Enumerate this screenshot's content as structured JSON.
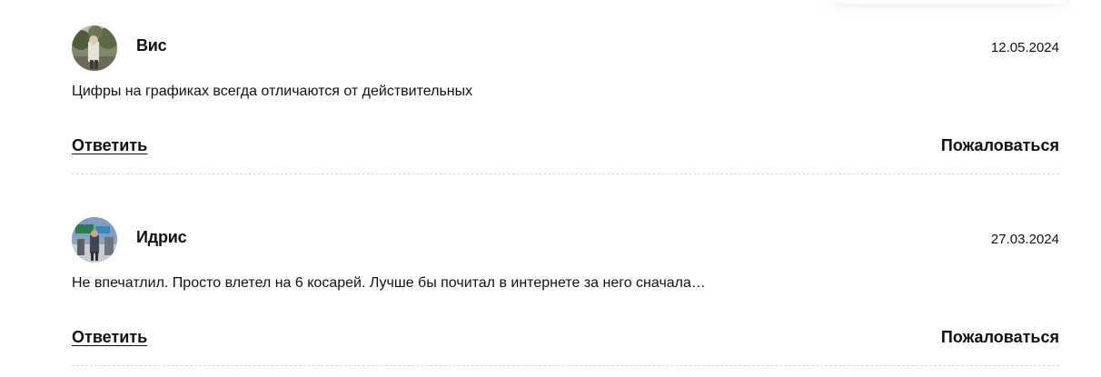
{
  "comments": [
    {
      "author": "Вис",
      "date": "12.05.2024",
      "text": "Цифры на графиках всегда отличаются от действительных",
      "reply_label": "Ответить",
      "report_label": "Пожаловаться",
      "avatar_icon": "user-photo-icon"
    },
    {
      "author": "Идрис",
      "date": "27.03.2024",
      "text": "Не впечатлил. Просто влетел на 6 косарей. Лучше бы почитал в интернете за него сначала…",
      "reply_label": "Ответить",
      "report_label": "Пожаловаться",
      "avatar_icon": "user-photo-icon"
    }
  ]
}
